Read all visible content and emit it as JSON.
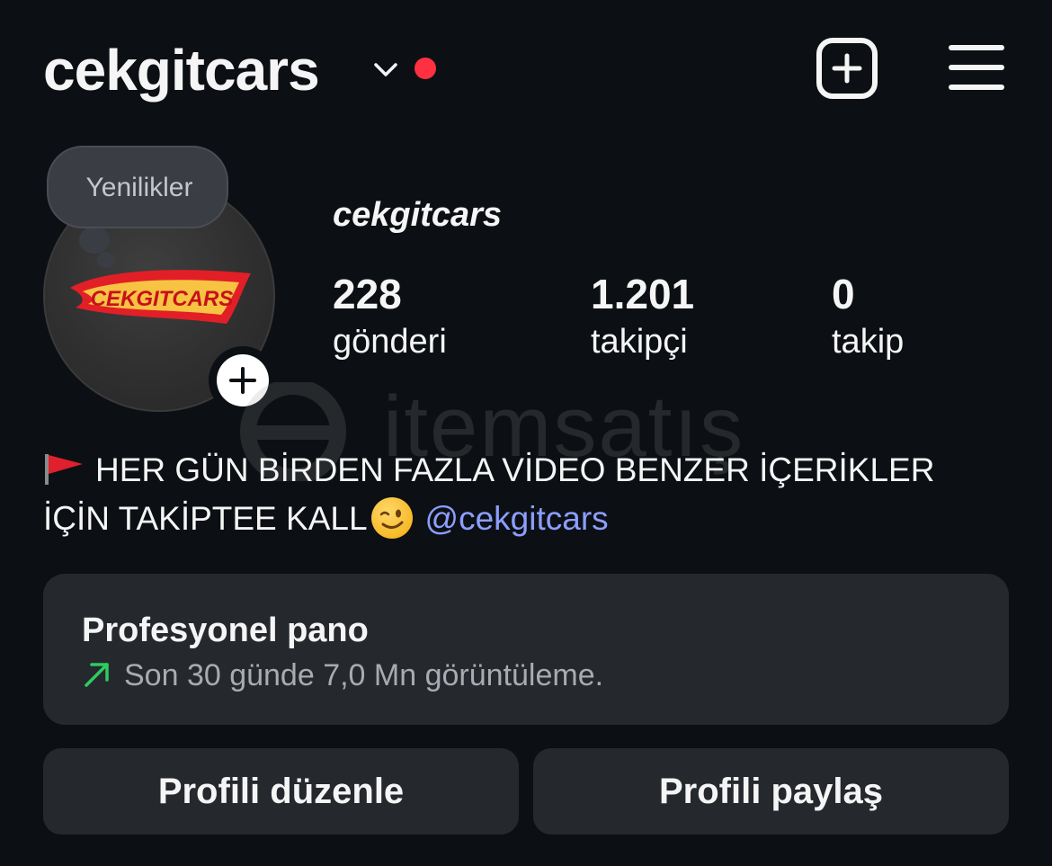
{
  "header": {
    "username": "cekgitcars",
    "icons": {
      "chevron": "chevron-down-icon",
      "live_dot": "notification-dot",
      "create": "plus-square-icon",
      "menu": "hamburger-menu-icon"
    },
    "live_dot_color": "#ff3040"
  },
  "avatar": {
    "logo_text": "CEKGITCARS",
    "note_bubble": "Yenilikler",
    "add_icon": "plus-icon"
  },
  "profile": {
    "display_name": "cekgitcars",
    "stats": [
      {
        "value": "228",
        "label": "gönderi"
      },
      {
        "value": "1.201",
        "label": "takipçi"
      },
      {
        "value": "0",
        "label": "takip"
      }
    ]
  },
  "watermark": {
    "text": "itemsatış"
  },
  "bio": {
    "line1": "HER GÜN BİRDEN FAZLA VİDEO BENZER İÇERİKLER",
    "line2": "İÇİN TAKİPTEE KALL",
    "mention": "@cekgitcars",
    "leading_emoji": "triangular-flag-icon",
    "trailing_emoji": "winking-face-icon",
    "mention_color": "#8c9eff"
  },
  "dashboard": {
    "title": "Profesyonel pano",
    "subtitle": "Son 30 günde 7,0 Mn görüntüleme.",
    "trend_icon": "arrow-up-right-icon",
    "trend_color": "#2fcb5f"
  },
  "buttons": {
    "edit": "Profili düzenle",
    "share": "Profili paylaş"
  }
}
